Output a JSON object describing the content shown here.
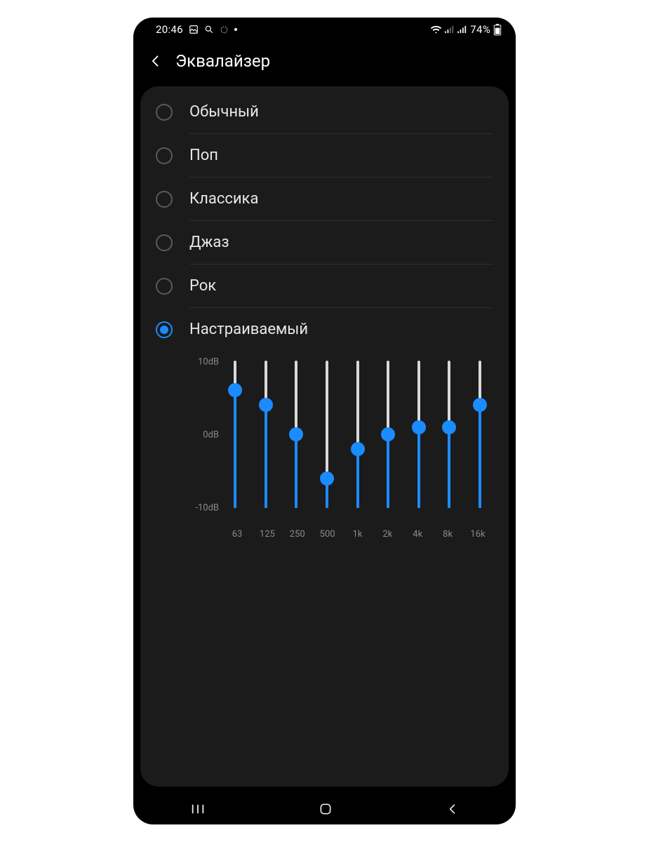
{
  "status": {
    "time": "20:46",
    "battery": "74%"
  },
  "header": {
    "title": "Эквалайзер"
  },
  "options": [
    {
      "label": "Обычный",
      "selected": false
    },
    {
      "label": "Поп",
      "selected": false
    },
    {
      "label": "Классика",
      "selected": false
    },
    {
      "label": "Джаз",
      "selected": false
    },
    {
      "label": "Рок",
      "selected": false
    },
    {
      "label": "Настраиваемый",
      "selected": true
    }
  ],
  "eq": {
    "y_top": "10dB",
    "y_mid": "0dB",
    "y_bot": "-10dB"
  },
  "chart_data": {
    "type": "slider-equalizer",
    "ylabel": "dB",
    "ylim": [
      -10,
      10
    ],
    "y_ticks": [
      -10,
      0,
      10
    ],
    "bands_hz": [
      "63",
      "125",
      "250",
      "500",
      "1k",
      "2k",
      "4k",
      "8k",
      "16k"
    ],
    "values_db": [
      6,
      4,
      0,
      -6,
      -2,
      0,
      1,
      1,
      4
    ]
  }
}
